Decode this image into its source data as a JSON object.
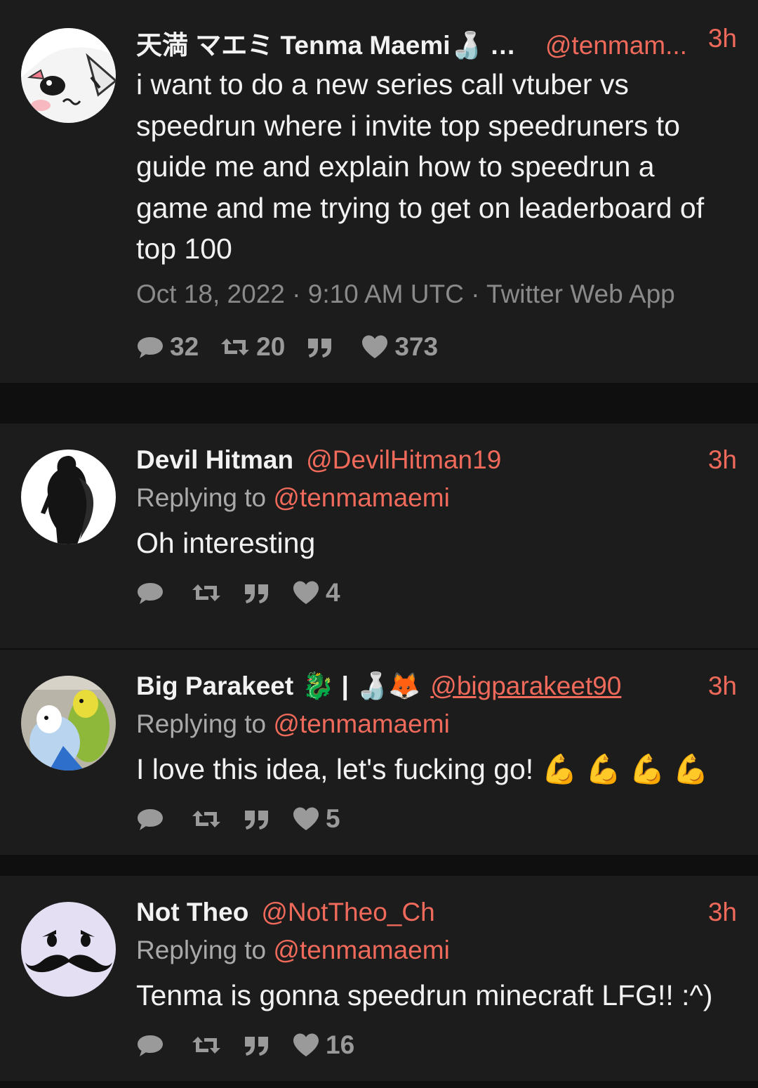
{
  "tweets": [
    {
      "name": "天満 マエミ Tenma Maemi",
      "name_suffix": "🍶 …",
      "handle": "@tenmam...",
      "time": "3h",
      "text": "i want to do a new series call vtuber vs speedrun where i invite top speedruners to guide me and explain how to speedrun a game and me trying to get on leaderboard of top 100",
      "meta": "Oct 18, 2022 · 9:10 AM UTC · Twitter Web App",
      "stats": {
        "replies": "32",
        "retweets": "20",
        "quotes": "",
        "likes": "373"
      },
      "avatar_icon": "anime-girl-avatar"
    },
    {
      "name": "Devil Hitman",
      "handle": "@DevilHitman19",
      "time": "3h",
      "replying_prefix": "Replying to ",
      "replying_handle": "@tenmamaemi",
      "text": "Oh interesting",
      "stats": {
        "replies": "",
        "retweets": "",
        "quotes": "",
        "likes": "4"
      },
      "avatar_icon": "silhouette-figure-avatar"
    },
    {
      "name": "Big Parakeet",
      "name_suffix": "🐉 | 🍶🦊",
      "handle": "@bigparakeet90",
      "time": "3h",
      "replying_prefix": "Replying to ",
      "replying_handle": "@tenmamaemi",
      "text": "I love this idea, let's fucking go! 💪 💪 💪 💪",
      "stats": {
        "replies": "",
        "retweets": "",
        "quotes": "",
        "likes": "5"
      },
      "avatar_icon": "parakeets-avatar"
    },
    {
      "name": "Not Theo",
      "handle": "@NotTheo_Ch",
      "time": "3h",
      "replying_prefix": "Replying to ",
      "replying_handle": "@tenmamaemi",
      "text": "Tenma is gonna speedrun minecraft LFG!! :^)",
      "stats": {
        "replies": "",
        "retweets": "",
        "quotes": "",
        "likes": "16"
      },
      "avatar_icon": "mustache-face-avatar"
    }
  ],
  "colors": {
    "background": "#0f0f0f",
    "card": "#1c1c1c",
    "accent": "#ef6a5a",
    "text": "#f2f2f2",
    "muted": "#8a8a8a"
  }
}
